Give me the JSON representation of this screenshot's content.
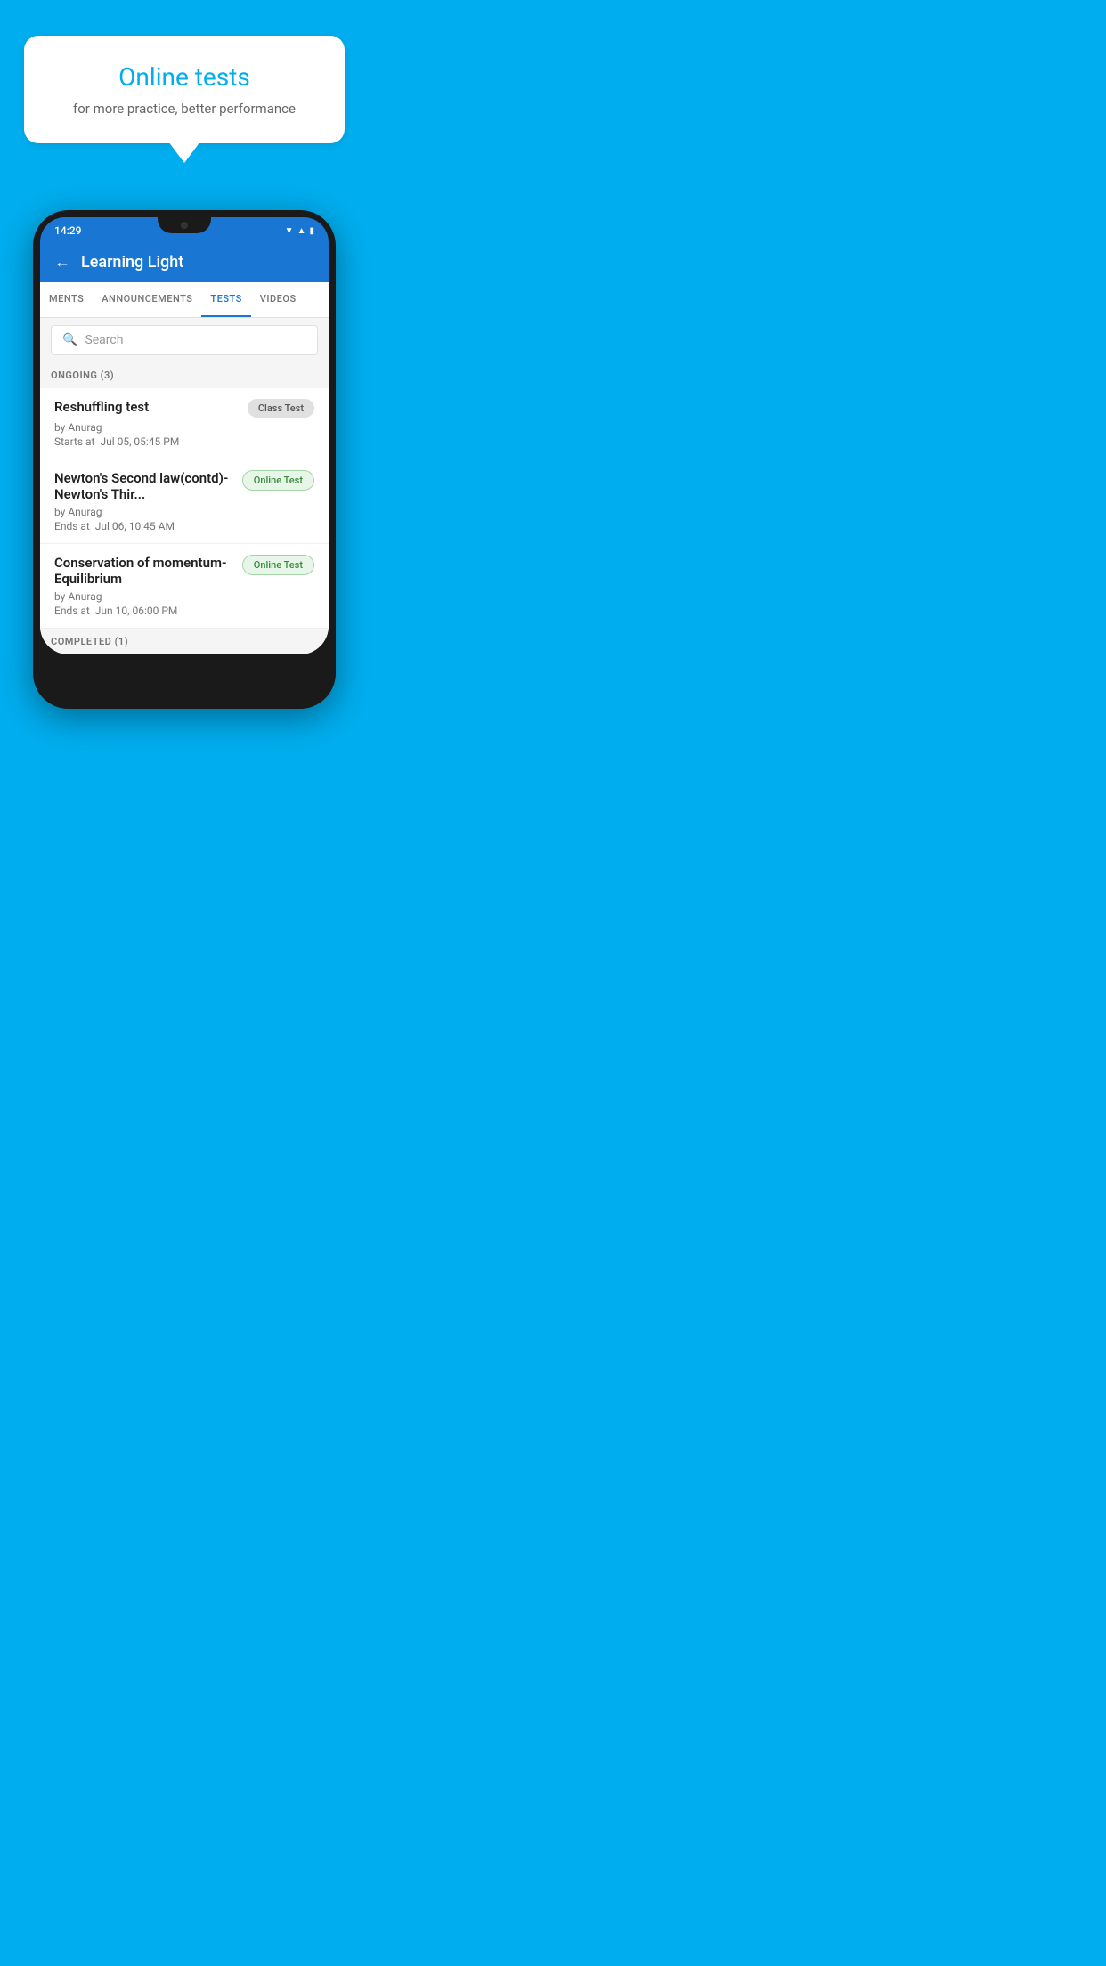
{
  "background_color": "#00AEEF",
  "promo": {
    "title": "Online tests",
    "subtitle": "for more practice, better performance"
  },
  "phone": {
    "time": "14:29",
    "app_title": "Learning Light",
    "back_label": "←"
  },
  "tabs": [
    {
      "label": "MENTS",
      "active": false
    },
    {
      "label": "ANNOUNCEMENTS",
      "active": false
    },
    {
      "label": "TESTS",
      "active": true
    },
    {
      "label": "VIDEOS",
      "active": false
    }
  ],
  "search": {
    "placeholder": "Search"
  },
  "ongoing_section": {
    "label": "ONGOING (3)"
  },
  "tests": [
    {
      "name": "Reshuffling test",
      "badge": "Class Test",
      "badge_type": "class",
      "by": "by Anurag",
      "date_label": "Starts at",
      "date": "Jul 05, 05:45 PM"
    },
    {
      "name": "Newton's Second law(contd)-Newton's Thir...",
      "badge": "Online Test",
      "badge_type": "online",
      "by": "by Anurag",
      "date_label": "Ends at",
      "date": "Jul 06, 10:45 AM"
    },
    {
      "name": "Conservation of momentum-Equilibrium",
      "badge": "Online Test",
      "badge_type": "online",
      "by": "by Anurag",
      "date_label": "Ends at",
      "date": "Jun 10, 06:00 PM"
    }
  ],
  "completed_section": {
    "label": "COMPLETED (1)"
  }
}
